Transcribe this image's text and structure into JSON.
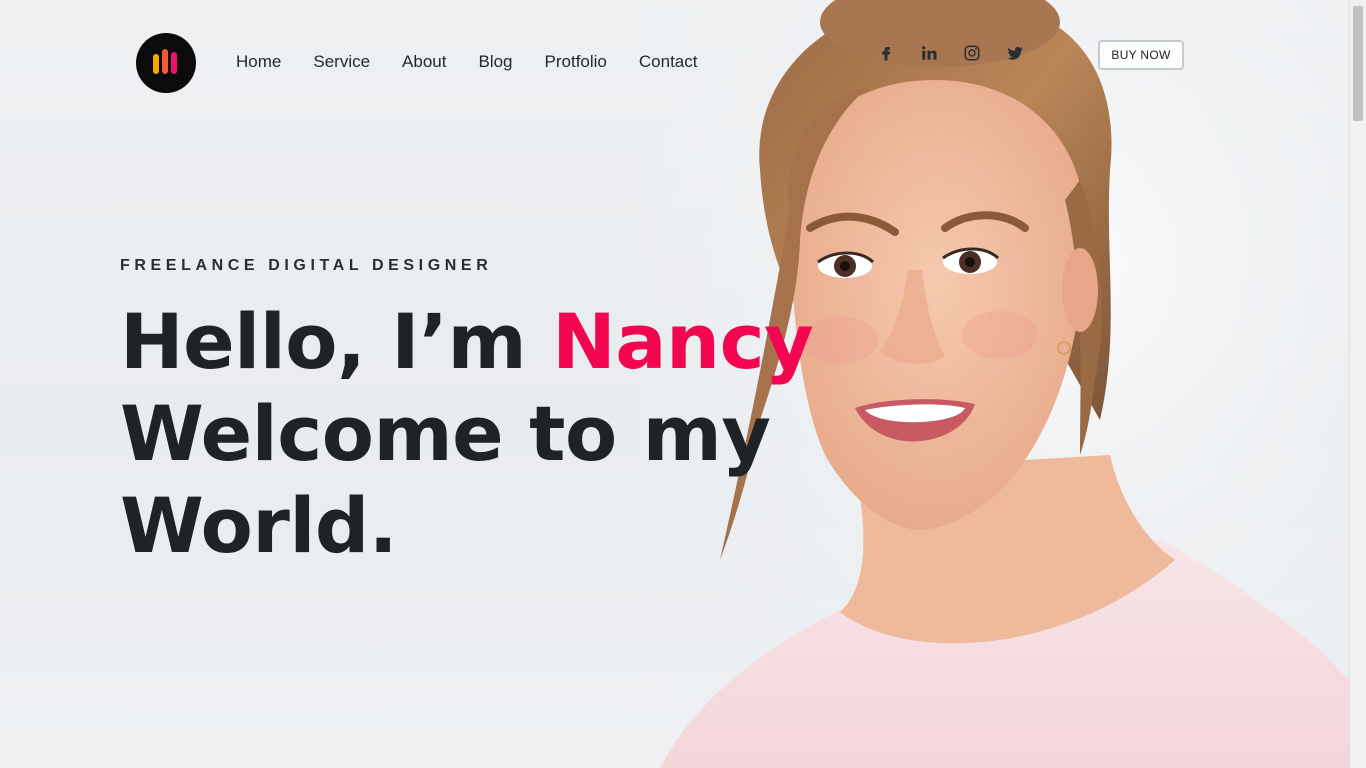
{
  "brand": {
    "logo_icon": "bar-chart-logo-icon",
    "colors": {
      "bar1": "#f6a800",
      "bar2": "#f25a2f",
      "bar3": "#f0106e",
      "background": "#0b0b0b"
    }
  },
  "nav": {
    "items": [
      {
        "label": "Home"
      },
      {
        "label": "Service"
      },
      {
        "label": "About"
      },
      {
        "label": "Blog"
      },
      {
        "label": "Protfolio"
      },
      {
        "label": "Contact"
      }
    ]
  },
  "social": [
    {
      "icon": "facebook-icon"
    },
    {
      "icon": "linkedin-icon"
    },
    {
      "icon": "instagram-icon"
    },
    {
      "icon": "twitter-icon"
    }
  ],
  "cta": {
    "label": "BUY NOW"
  },
  "hero": {
    "tagline": "FREELANCE DIGITAL DESIGNER",
    "greeting": "Hello, I’m ",
    "name": "Nancy",
    "line2": "Welcome to my",
    "line3": "World.",
    "accent_color": "#f2064f"
  }
}
